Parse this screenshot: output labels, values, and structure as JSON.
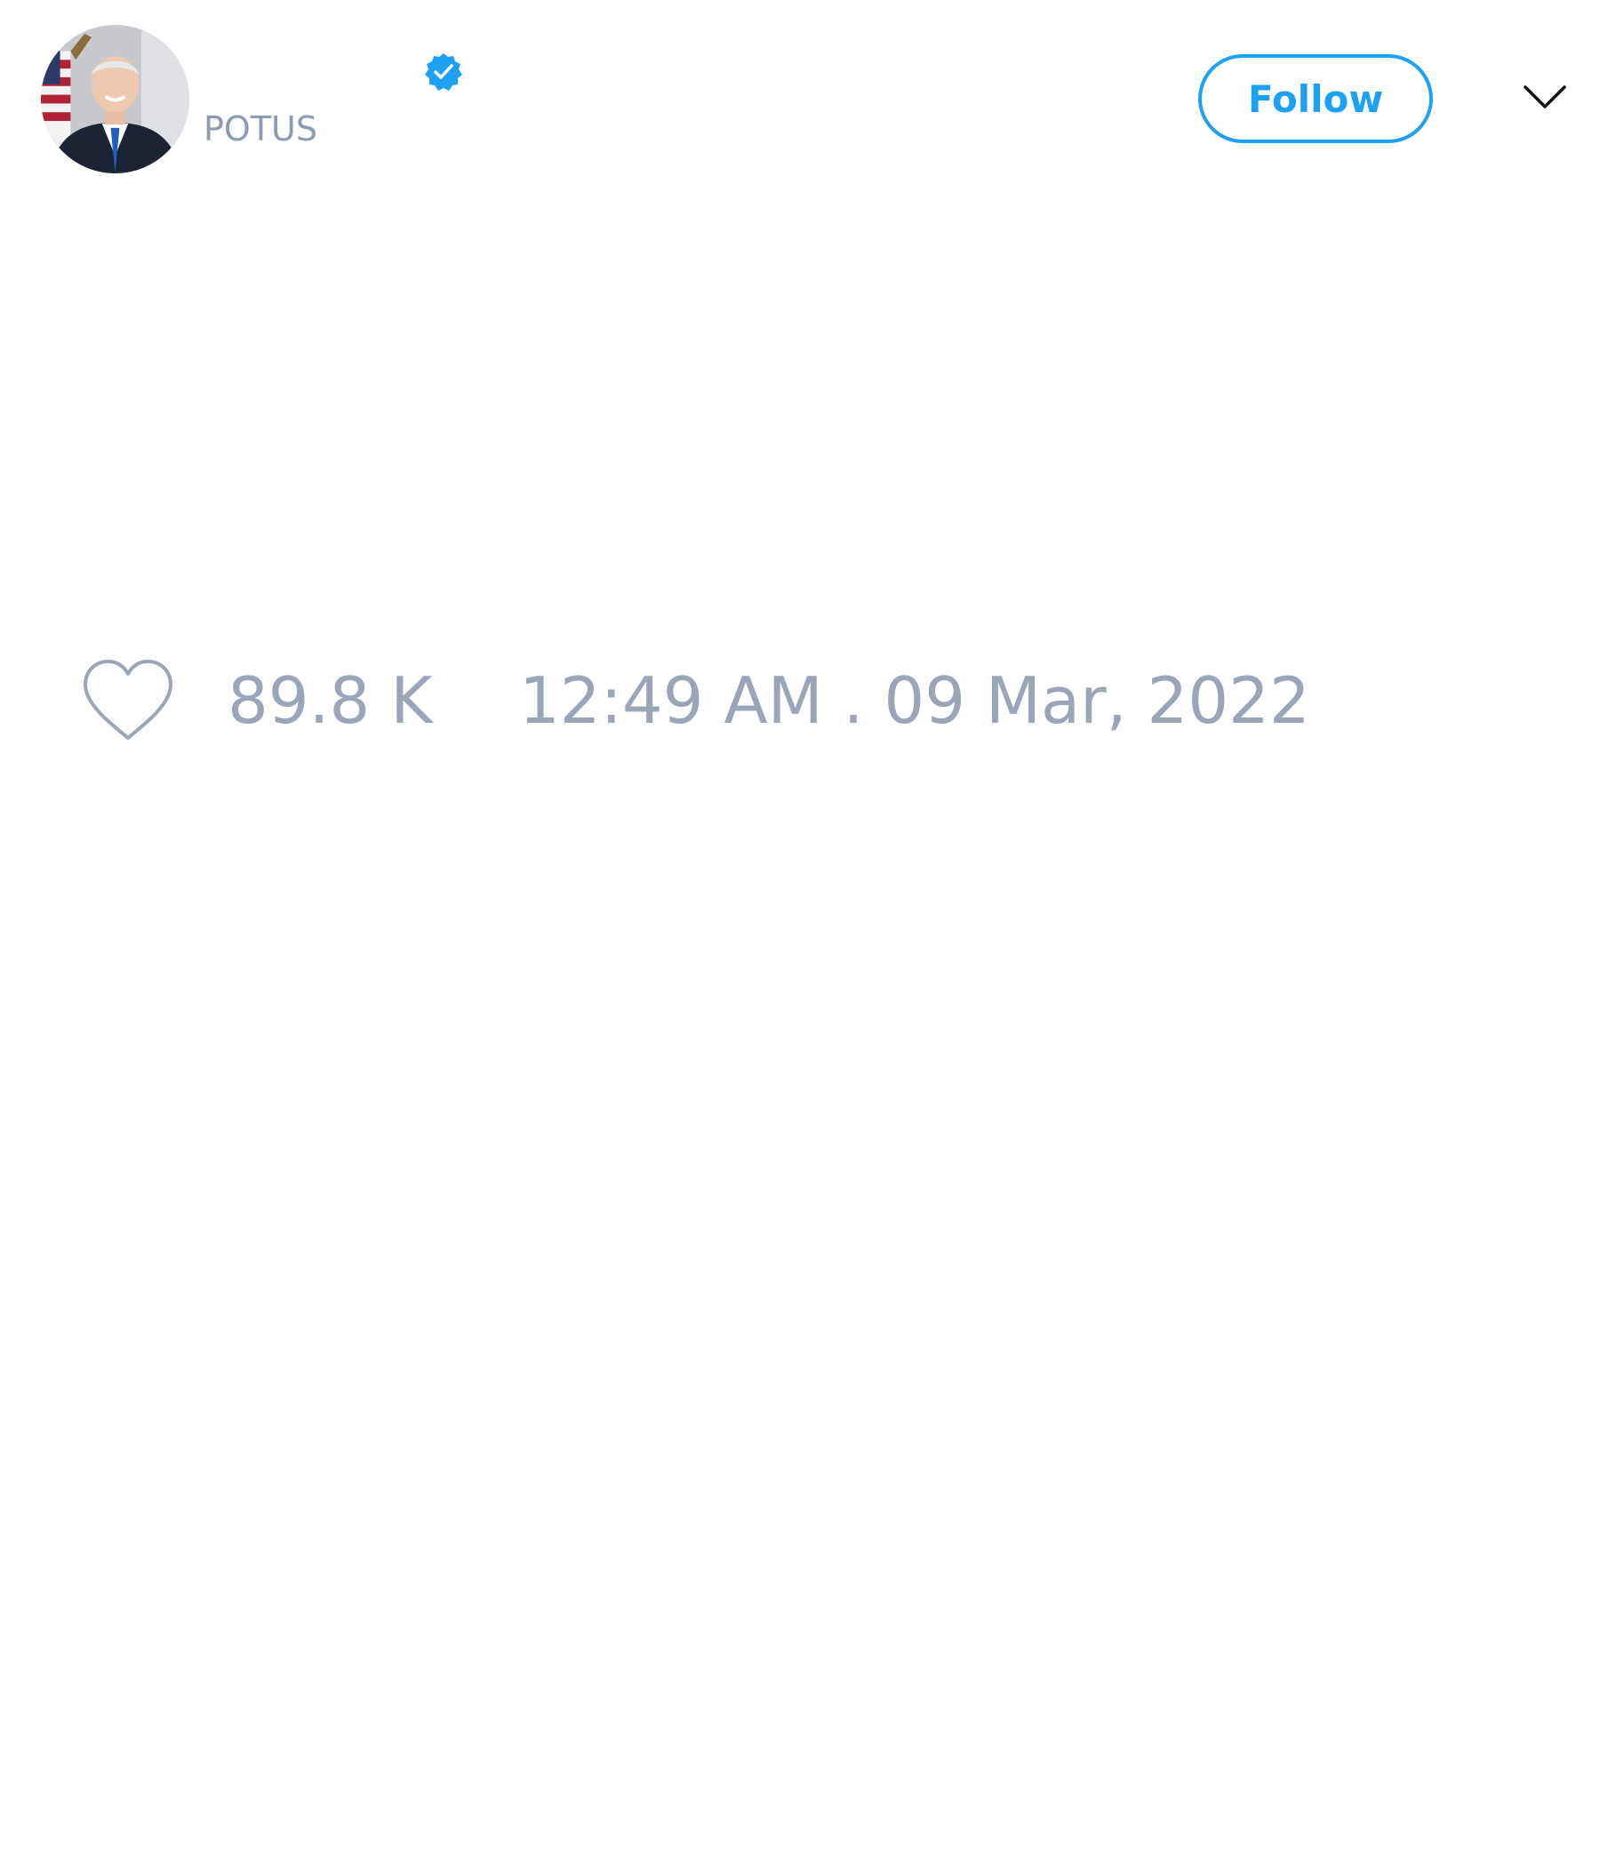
{
  "author": {
    "display_name": "",
    "handle": "POTUS",
    "verified": true,
    "avatar": "presidential-portrait-avatar"
  },
  "actions": {
    "follow_label": "Follow",
    "more_icon": "chevron-down-icon"
  },
  "tweet": {
    "text": ""
  },
  "engagement": {
    "like_icon": "heart-outline-icon",
    "like_count": "89.8 K",
    "timestamp": "12:49 AM . 09 Mar, 2022"
  },
  "colors": {
    "accent": "#1da1f2",
    "muted_text": "#9aa5b7",
    "handle_text": "#8e9bb0"
  }
}
